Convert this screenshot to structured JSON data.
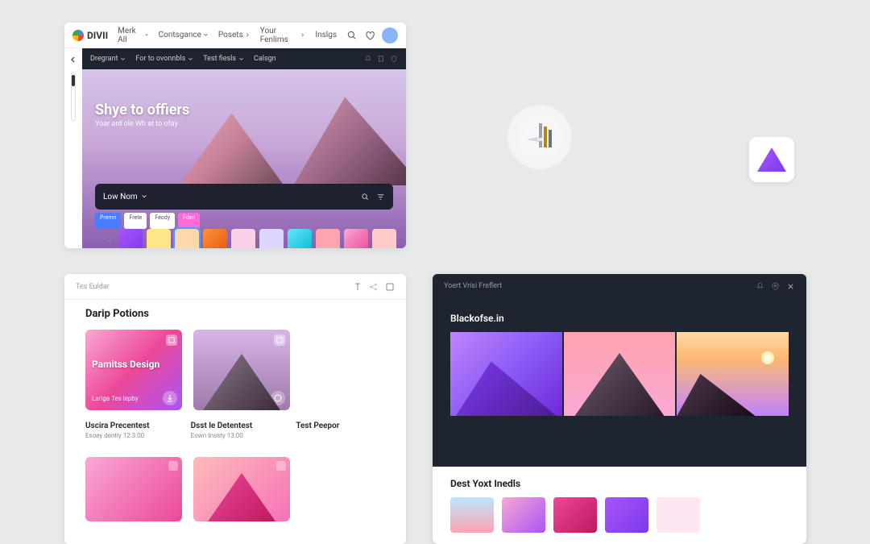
{
  "panel1": {
    "logo": "DIVII",
    "nav": [
      {
        "label": "Merk All"
      },
      {
        "label": "Contsgance"
      },
      {
        "label": "Posets"
      },
      {
        "label": "Your Fenlims"
      },
      {
        "label": "Inslgs"
      }
    ],
    "subnav": [
      {
        "label": "Dregrant"
      },
      {
        "label": "For to ovonnbls"
      },
      {
        "label": "Test fiesls"
      },
      {
        "label": "Calsgn"
      }
    ],
    "hero": {
      "title": "Shye to offiers",
      "subtitle": "Yoar ard ole Wb at to ofay"
    },
    "search": {
      "label": "Low Nom"
    },
    "pills": [
      {
        "label": "Premn",
        "cls": "blue"
      },
      {
        "label": "Frete",
        "cls": ""
      },
      {
        "label": "Feody",
        "cls": ""
      },
      {
        "label": "Fden",
        "cls": "pink"
      }
    ]
  },
  "panel2": {
    "tab": "Tes Euldar",
    "title": "Darip Potions",
    "card1": {
      "title": "Pamitss Design",
      "sub": "Lariga Tes lepby"
    },
    "items": [
      {
        "title": "Uscira Precentest",
        "sub": "Esoey dentiy 12:3:00"
      },
      {
        "title": "Dsst le Detentest",
        "sub": "Eown  tnssty 13:00"
      },
      {
        "title": "Test Peepor",
        "sub": ""
      }
    ]
  },
  "panel3": {
    "tab": "Yoert Vrisi Freflert",
    "title": "Blackofse.in",
    "btitle": "Dest Yoxt Inedls"
  }
}
